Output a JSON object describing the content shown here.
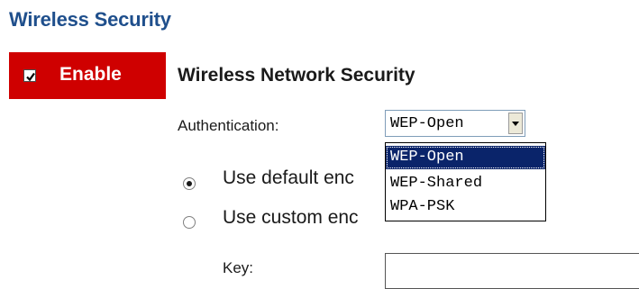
{
  "page": {
    "title": "Wireless Security"
  },
  "enable": {
    "label": "Enable",
    "checked": true,
    "background": "#cf0000"
  },
  "section": {
    "title": "Wireless Network Security"
  },
  "authentication": {
    "label": "Authentication:",
    "selected": "WEP-Open",
    "options": [
      "WEP-Open",
      "WEP-Shared",
      "WPA-PSK"
    ]
  },
  "encryption": {
    "default_label": "Use default enc",
    "custom_label": "Use custom enc",
    "selected": "default"
  },
  "key": {
    "label": "Key:",
    "value": ""
  },
  "colors": {
    "title": "#1f4f8c",
    "highlight": "#0a246a"
  }
}
